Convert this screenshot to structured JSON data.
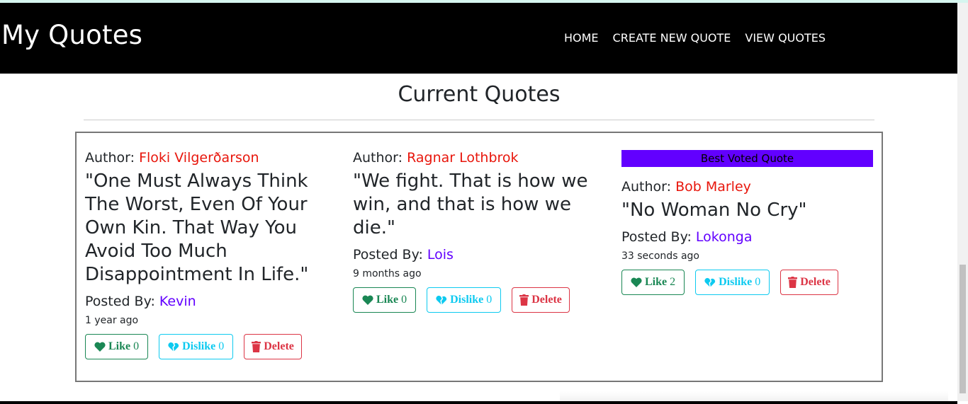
{
  "nav": {
    "brand": "My Quotes",
    "links": [
      "HOME",
      "CREATE NEW QUOTE",
      "VIEW QUOTES"
    ]
  },
  "main": {
    "title": "Current Quotes",
    "author_label": "Author: ",
    "posted_label": "Posted By: ",
    "like_label": "Like",
    "dislike_label": "Dislike",
    "delete_label": "Delete",
    "best_label": "Best Voted Quote",
    "quotes": [
      {
        "author": "Floki Vilgerðarson",
        "text": "\"One Must Always Think The Worst, Even Of Your Own Kin. That Way You Avoid Too Much Disappointment In Life.\"",
        "posted_by": "Kevin",
        "ago": "1 year ago",
        "likes": "0",
        "dislikes": "0"
      },
      {
        "author": "Ragnar Lothbrok",
        "text": "\"We fight. That is how we win, and that is how we die.\"",
        "posted_by": "Lois",
        "ago": "9 months ago",
        "likes": "0",
        "dislikes": "0"
      },
      {
        "author": "Bob Marley",
        "text": "\"No Woman No Cry\"",
        "posted_by": "Lokonga",
        "ago": "33 seconds ago",
        "likes": "2",
        "dislikes": "0"
      }
    ]
  },
  "colors": {
    "author": "#e8160c",
    "poster": "#6200ff",
    "best_badge": "#6200ff",
    "like": "#1a8754",
    "dislike": "#0dcaf0",
    "delete": "#dc3545"
  },
  "icons": {
    "like": "heart-icon",
    "dislike": "broken-heart-icon",
    "delete": "trash-icon"
  }
}
